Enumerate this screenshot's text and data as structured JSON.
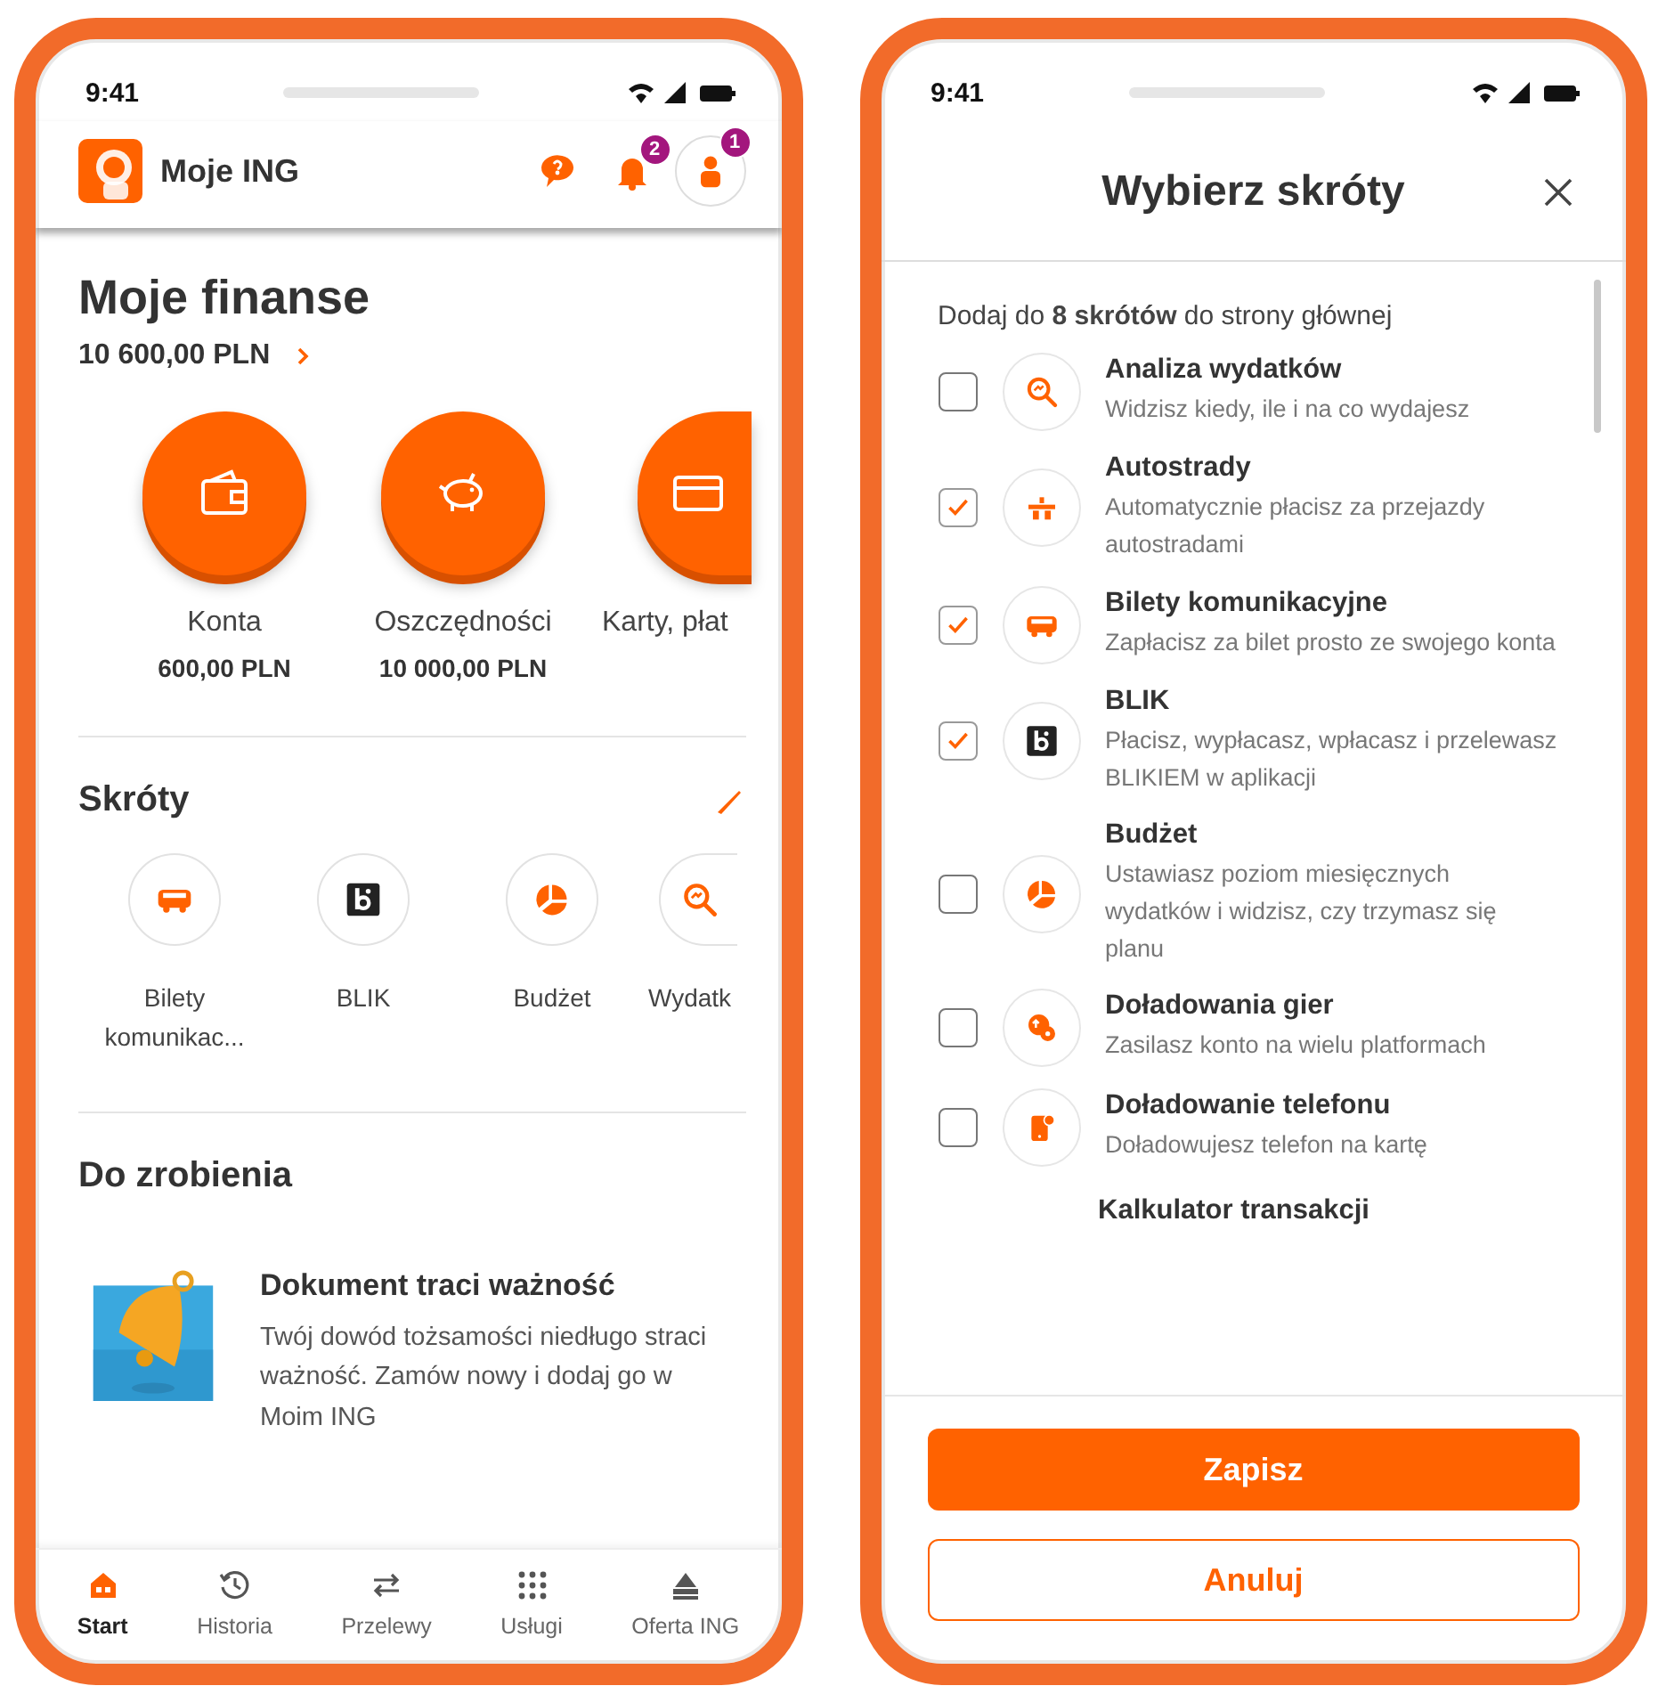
{
  "home_screen": {
    "status_time": "9:41",
    "app_title": "Moje ING",
    "notification_badge": "2",
    "profile_badge": "1",
    "finances": {
      "title": "Moje finanse",
      "total": "10 600,00 PLN",
      "products": [
        {
          "label": "Konta",
          "amount": "600,00 PLN"
        },
        {
          "label": "Oszczędności",
          "amount": "10 000,00 PLN"
        },
        {
          "label": "Karty, płat"
        }
      ]
    },
    "shortcuts": {
      "title": "Skróty",
      "items": [
        {
          "label": "Bilety komunikac..."
        },
        {
          "label": "BLIK"
        },
        {
          "label": "Budżet"
        },
        {
          "label": "Wydatk"
        }
      ]
    },
    "todo": {
      "title": "Do zrobienia",
      "items": [
        {
          "title": "Dokument traci ważność",
          "text": "Twój dowód tożsamości niedługo straci ważność. Zamów nowy i dodaj go w Moim ING"
        }
      ]
    },
    "nav": [
      {
        "label": "Start",
        "selected": true
      },
      {
        "label": "Historia",
        "selected": false
      },
      {
        "label": "Przelewy",
        "selected": false
      },
      {
        "label": "Usługi",
        "selected": false
      },
      {
        "label": "Oferta ING",
        "selected": false
      }
    ]
  },
  "picker_screen": {
    "status_time": "9:41",
    "title": "Wybierz skróty",
    "intro": "Dodaj do **8 skrótów** do strony głównej",
    "options": [
      {
        "title": "Analiza wydatków",
        "description": "Widzisz kiedy, ile i na co wydajesz",
        "checked": false
      },
      {
        "title": "Autostrady",
        "description": "Automatycznie płacisz za przejazdy autostradami",
        "checked": true
      },
      {
        "title": "Bilety komunikacyjne",
        "description": "Zapłacisz za bilet prosto ze swojego konta",
        "checked": true
      },
      {
        "title": "BLIK",
        "description": "Płacisz, wypłacasz, wpłacasz i przelewasz BLIKIEM w aplikacji",
        "checked": true
      },
      {
        "title": "Budżet",
        "description": "Ustawiasz poziom miesięcznych wydatków i widzisz, czy trzymasz się planu",
        "checked": false
      },
      {
        "title": "Doładowania gier",
        "description": "Zasilasz konto na wielu platformach",
        "checked": false
      },
      {
        "title": "Doładowanie telefonu",
        "description": "Doładowujesz telefon na kartę",
        "checked": false
      }
    ],
    "cut_option_title": "Kalkulator transakcji",
    "buttons": [
      "Zapisz",
      "Anuluj"
    ]
  }
}
